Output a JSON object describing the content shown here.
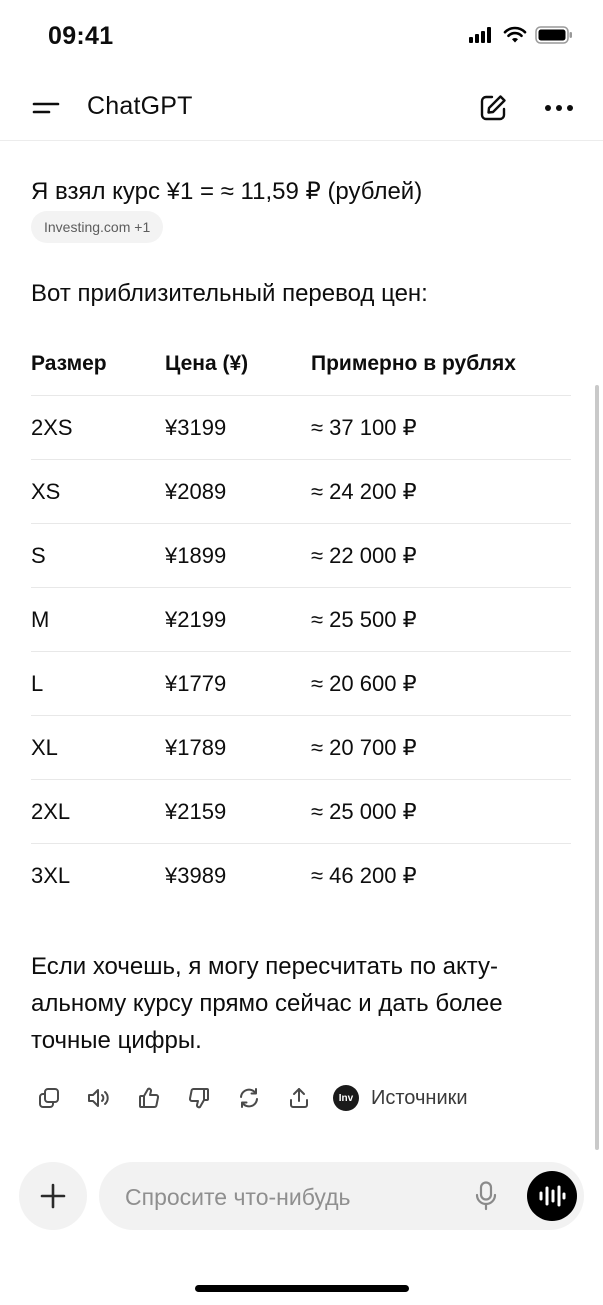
{
  "status_bar": {
    "time": "09:41"
  },
  "header": {
    "title": "ChatGPT"
  },
  "message": {
    "intro": "Я взял курс ¥1 = ≈ 11,59 ₽ (рублей)",
    "source_chip": "Investing.com +1",
    "lead": "Вот приблизительный перевод цен:",
    "table": {
      "headers": [
        "Размер",
        "Цена (¥)",
        "Примерно в рублях"
      ],
      "rows": [
        [
          "2XS",
          "¥3199",
          "≈ 37 100 ₽"
        ],
        [
          "XS",
          "¥2089",
          "≈ 24 200 ₽"
        ],
        [
          "S",
          "¥1899",
          "≈ 22 000 ₽"
        ],
        [
          "M",
          "¥2199",
          "≈ 25 500 ₽"
        ],
        [
          "L",
          "¥1779",
          "≈ 20 600 ₽"
        ],
        [
          "XL",
          "¥1789",
          "≈ 20 700 ₽"
        ],
        [
          "2XL",
          "¥2159",
          "≈ 25 000 ₽"
        ],
        [
          "3XL",
          "¥3989",
          "≈ 46 200 ₽"
        ]
      ]
    },
    "follow_up": "Если хочешь, я могу пересчитать по акту-альному курсу прямо сейчас и дать более точные цифры."
  },
  "actions": {
    "icons": [
      "copy-icon",
      "speaker-icon",
      "thumbs-up-icon",
      "thumbs-down-icon",
      "regenerate-icon",
      "share-icon"
    ],
    "sources_logo": "Inv",
    "sources_label": "Источники"
  },
  "composer": {
    "placeholder": "Спросите что-нибудь"
  }
}
